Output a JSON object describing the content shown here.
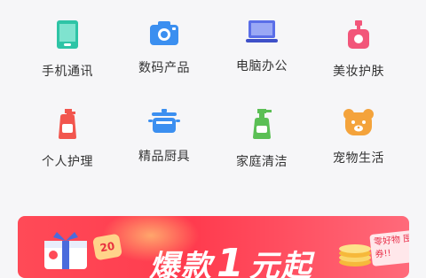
{
  "categories": [
    {
      "label": "手机通讯",
      "icon": "phone-icon",
      "color": "#2ec4a6"
    },
    {
      "label": "数码产品",
      "icon": "camera-icon",
      "color": "#3b8ff0"
    },
    {
      "label": "电脑办公",
      "icon": "laptop-icon",
      "color": "#5a6ee8"
    },
    {
      "label": "美妆护肤",
      "icon": "perfume-icon",
      "color": "#f2567a"
    },
    {
      "label": "个人护理",
      "icon": "bottle-icon",
      "color": "#f2564e"
    },
    {
      "label": "精品厨具",
      "icon": "pot-icon",
      "color": "#3b8ff0"
    },
    {
      "label": "家庭清洁",
      "icon": "spray-icon",
      "color": "#5bbf55"
    },
    {
      "label": "宠物生活",
      "icon": "pet-icon",
      "color": "#f4a33b"
    }
  ],
  "banner": {
    "headline_pre": "爆款",
    "headline_num": "1",
    "headline_post": "元起",
    "ticket": "20",
    "tag": "零好物 囤券!!",
    "background": "#ff3b4e"
  }
}
